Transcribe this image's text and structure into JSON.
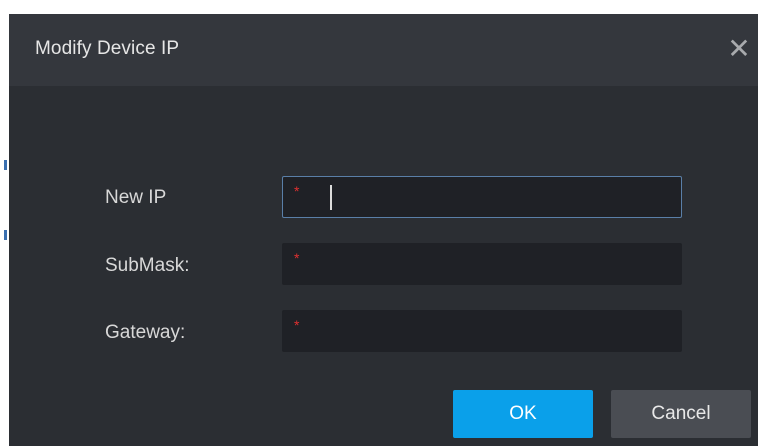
{
  "dialog": {
    "title": "Modify Device IP",
    "close_icon": "close-icon"
  },
  "form": {
    "fields": [
      {
        "label": "New IP",
        "value": "",
        "required_mark": "*",
        "focused": true
      },
      {
        "label": "SubMask:",
        "value": "",
        "required_mark": "*",
        "focused": false
      },
      {
        "label": "Gateway:",
        "value": "",
        "required_mark": "*",
        "focused": false
      }
    ]
  },
  "buttons": {
    "ok_label": "OK",
    "cancel_label": "Cancel"
  },
  "colors": {
    "dialog_bg": "#2b2e33",
    "titlebar_bg": "#34373d",
    "input_bg": "#1f2126",
    "ok_bg": "#0aa0ea",
    "cancel_bg": "#4a4d53",
    "required": "#e03030"
  }
}
